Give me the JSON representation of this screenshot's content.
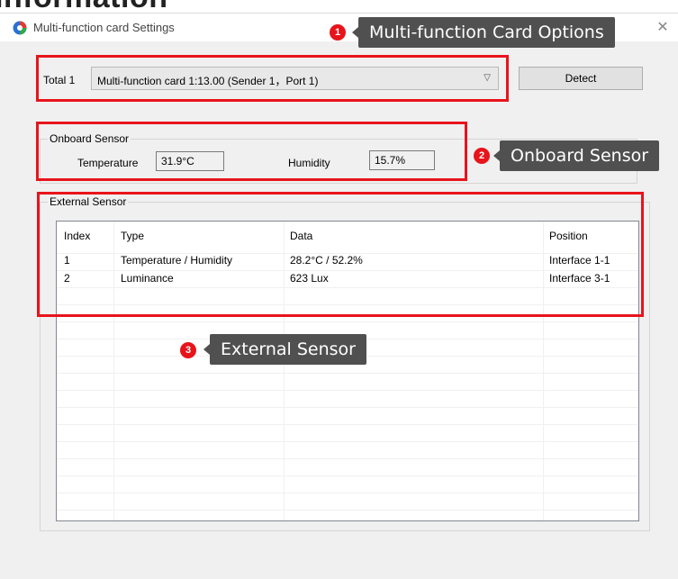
{
  "background_heading": "Information",
  "window": {
    "title": "Multi-function card Settings",
    "close_glyph": "✕"
  },
  "card_selector": {
    "total_label": "Total 1",
    "selected_value": "Multi-function card 1:13.00 (Sender 1，Port 1)",
    "detect_label": "Detect"
  },
  "onboard_sensor": {
    "group_title": "Onboard Sensor",
    "temperature_label": "Temperature",
    "temperature_value": "31.9°C",
    "humidity_label": "Humidity",
    "humidity_value": "15.7%"
  },
  "external_sensor": {
    "group_title": "External Sensor",
    "columns": [
      "Index",
      "Type",
      "Data",
      "Position"
    ],
    "rows": [
      {
        "index": "1",
        "type": "Temperature / Humidity",
        "data": "28.2°C / 52.2%",
        "position": "Interface 1-1"
      },
      {
        "index": "2",
        "type": "Luminance",
        "data": "623 Lux",
        "position": "Interface 3-1"
      }
    ]
  },
  "annotations": [
    {
      "number": "1",
      "label": "Multi-function Card Options"
    },
    {
      "number": "2",
      "label": "Onboard Sensor"
    },
    {
      "number": "3",
      "label": "External Sensor"
    }
  ],
  "colors": {
    "annotation_red": "#e8141b",
    "callout_bg": "#505050",
    "dialog_bg": "#f0f0f0"
  }
}
